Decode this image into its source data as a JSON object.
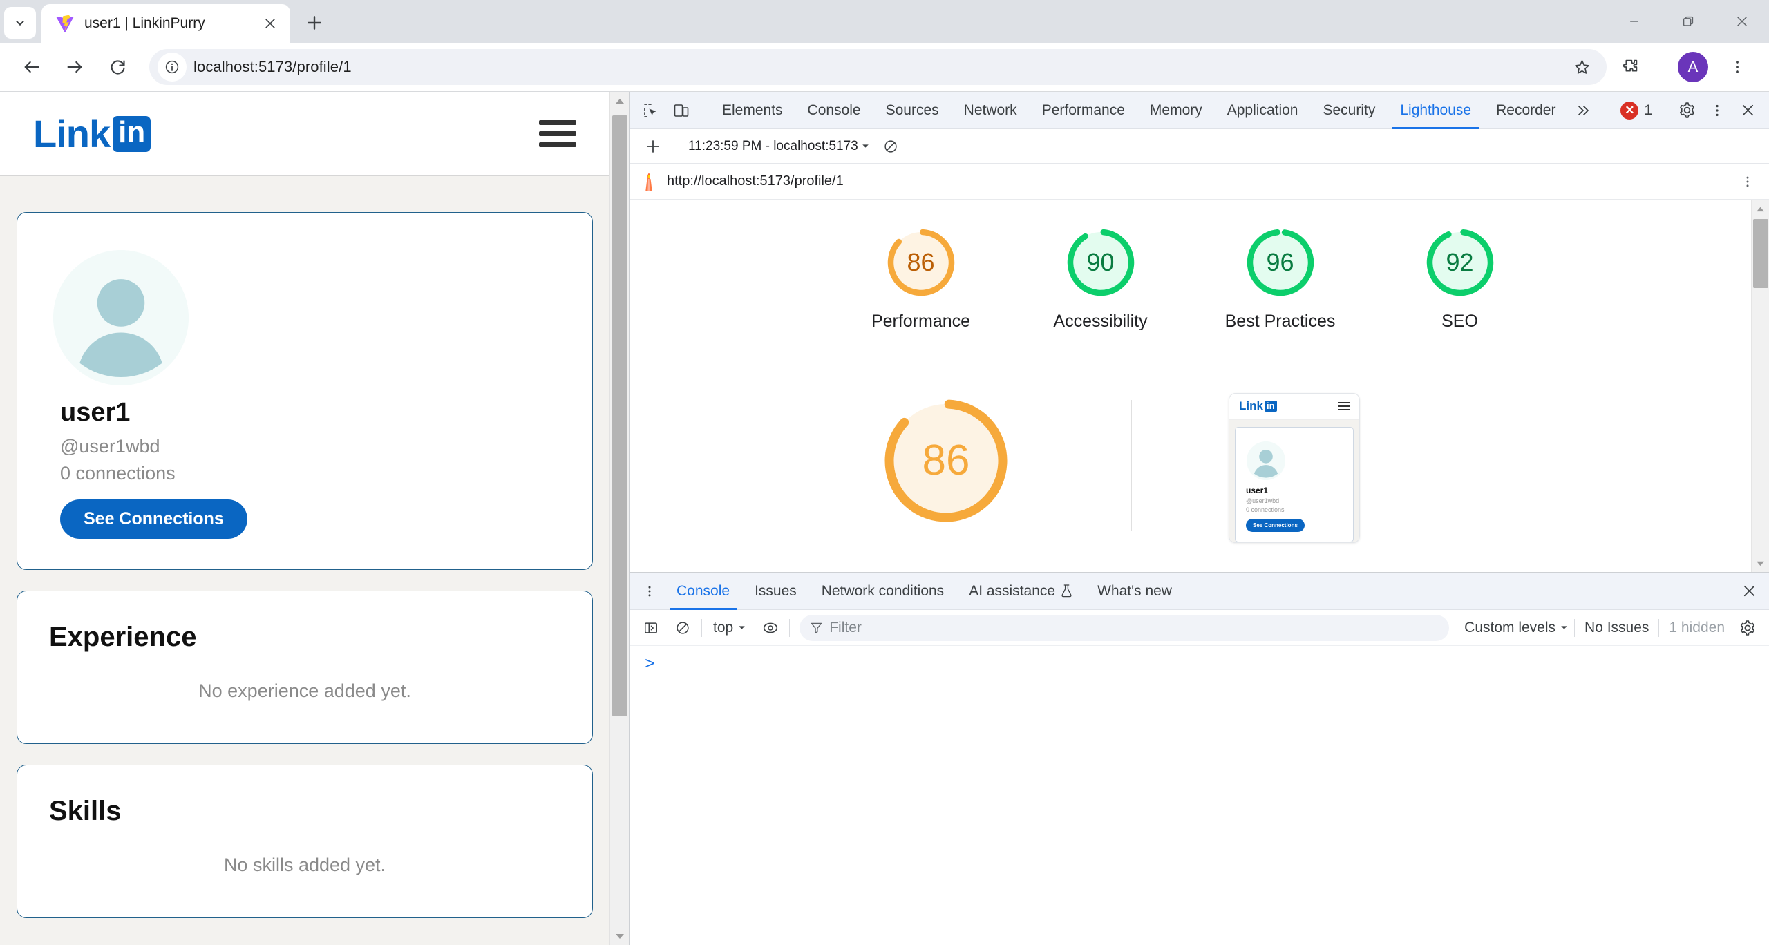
{
  "browser": {
    "tab": {
      "title": "user1 | LinkinPurry",
      "favicon": "vite-icon",
      "close_icon": "close-icon"
    },
    "new_tab_icon": "plus-icon",
    "tab_search_icon": "chevron-down-icon",
    "window": {
      "minimize": "minimize-icon",
      "maximize": "maximize-icon",
      "close": "close-icon"
    },
    "nav": {
      "back": "back-arrow-icon",
      "forward": "forward-arrow-icon",
      "reload": "reload-icon"
    },
    "omnibox": {
      "url": "localhost:5173/profile/1",
      "info_icon": "site-info-icon",
      "star_icon": "bookmark-star-icon"
    },
    "extensions_icon": "puzzle-piece-icon",
    "profile_avatar": "A",
    "menu_icon": "three-dot-menu-icon"
  },
  "webpage": {
    "logo": {
      "link_text": "Link",
      "in_text": "in"
    },
    "menu_icon": "hamburger-menu-icon",
    "profile": {
      "name": "user1",
      "handle": "@user1wbd",
      "connections": "0 connections",
      "button_label": "See Connections",
      "avatar_icon": "person-avatar-icon"
    },
    "sections": [
      {
        "title": "Experience",
        "empty_text": "No experience added yet."
      },
      {
        "title": "Skills",
        "empty_text": "No skills added yet."
      }
    ]
  },
  "devtools": {
    "inspect_icon": "inspect-element-icon",
    "device_icon": "device-toolbar-icon",
    "tabs": [
      {
        "label": "Elements",
        "active": false
      },
      {
        "label": "Console",
        "active": false
      },
      {
        "label": "Sources",
        "active": false
      },
      {
        "label": "Network",
        "active": false
      },
      {
        "label": "Performance",
        "active": false
      },
      {
        "label": "Memory",
        "active": false
      },
      {
        "label": "Application",
        "active": false
      },
      {
        "label": "Security",
        "active": false
      },
      {
        "label": "Lighthouse",
        "active": true
      },
      {
        "label": "Recorder",
        "active": false
      }
    ],
    "more_tabs_icon": "chevron-double-right-icon",
    "error_count": "1",
    "error_icon": "error-circle-icon",
    "settings_icon": "gear-icon",
    "menu_icon": "three-dot-menu-icon",
    "close_icon": "close-icon",
    "lighthouse": {
      "add_icon": "plus-icon",
      "run_label": "11:23:59 PM - localhost:5173",
      "run_dropdown_icon": "chevron-down-icon",
      "clear_icon": "clear-circle-icon",
      "report_url": "http://localhost:5173/profile/1",
      "report_icon": "lighthouse-icon",
      "report_menu_icon": "three-dot-menu-icon",
      "primary_score": "86",
      "mobile_preview": {
        "logo_link": "Link",
        "logo_in": "in",
        "name": "user1",
        "handle": "@user1wbd",
        "connections": "0 connections",
        "button_label": "See Connections"
      }
    }
  },
  "drawer": {
    "menu_icon": "three-dot-menu-icon",
    "tabs": [
      {
        "label": "Console",
        "active": true,
        "icon": null
      },
      {
        "label": "Issues",
        "active": false,
        "icon": null
      },
      {
        "label": "Network conditions",
        "active": false,
        "icon": null
      },
      {
        "label": "AI assistance",
        "active": false,
        "icon": "flask-icon"
      },
      {
        "label": "What's new",
        "active": false,
        "icon": null
      }
    ],
    "close_icon": "close-icon",
    "console": {
      "sidebar_icon": "console-sidebar-icon",
      "clear_icon": "clear-console-icon",
      "context_label": "top",
      "context_dropdown_icon": "chevron-down-icon",
      "eye_icon": "live-expression-icon",
      "filter_icon": "filter-funnel-icon",
      "filter_placeholder": "Filter",
      "levels_label": "Custom levels",
      "levels_dropdown_icon": "chevron-down-icon",
      "issues_label": "No Issues",
      "hidden_label": "1 hidden",
      "settings_icon": "gear-icon",
      "prompt": ">"
    }
  },
  "chart_data": {
    "type": "bar",
    "title": "Lighthouse category scores",
    "categories": [
      "Performance",
      "Accessibility",
      "Best Practices",
      "SEO"
    ],
    "values": [
      86,
      90,
      96,
      92
    ],
    "ylim": [
      0,
      100
    ],
    "colors": [
      "#f6a93b",
      "#0cce6b",
      "#0cce6b",
      "#0cce6b"
    ],
    "track_colors": [
      "#fef3e3",
      "#e3fcef",
      "#e3fcef",
      "#e3fcef"
    ],
    "text_colors": [
      "#bb5f06",
      "#0a7c41",
      "#0a7c41",
      "#0a7c41"
    ]
  },
  "colors": {
    "brand_blue": "#0a66c2",
    "devtools_accent": "#1a73e8",
    "score_pass": "#0cce6b",
    "score_average": "#f6a93b",
    "error_red": "#d93025"
  }
}
